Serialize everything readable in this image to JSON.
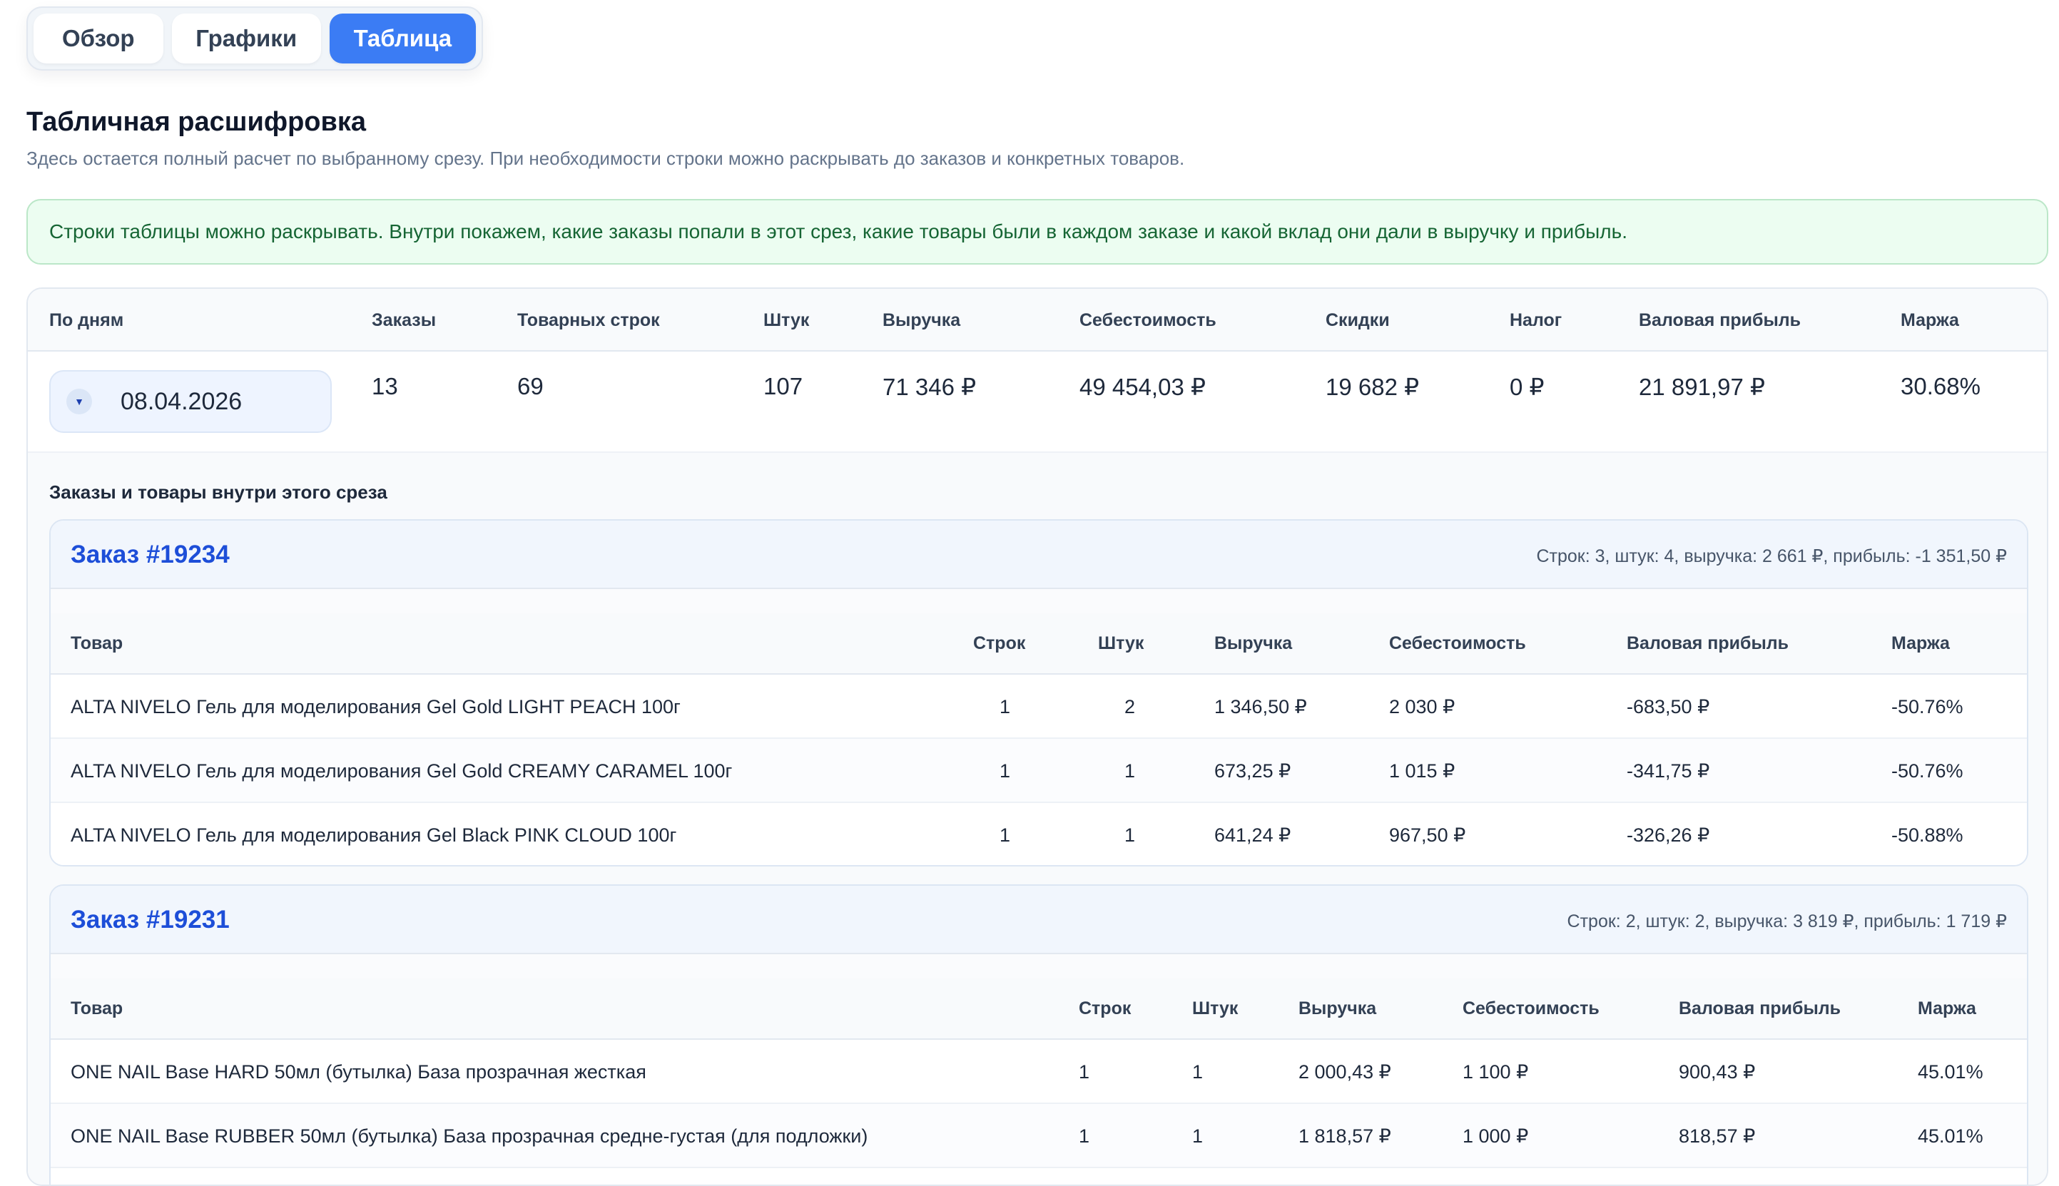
{
  "tabs": [
    {
      "label": "Обзор",
      "active": false
    },
    {
      "label": "Графики",
      "active": false
    },
    {
      "label": "Таблица",
      "active": true
    }
  ],
  "accent_color": "#3b7cf4",
  "section": {
    "title": "Табличная расшифровка",
    "subtitle": "Здесь остается полный расчет по выбранному срезу. При необходимости строки можно раскрывать до заказов и конкретных товаров."
  },
  "notice": "Строки таблицы можно раскрывать. Внутри покажем, какие заказы попали в этот срез, какие товары были в каждом заказе и какой вклад они дали в выручку и прибыль.",
  "table": {
    "headers": [
      "По дням",
      "Заказы",
      "Товарных строк",
      "Штук",
      "Выручка",
      "Себестоимость",
      "Скидки",
      "Налог",
      "Валовая прибыль",
      "Маржа"
    ],
    "row": {
      "expand_icon": "chevron-down-icon",
      "date": "08.04.2026",
      "orders": "13",
      "lines": "69",
      "units": "107",
      "revenue": "71 346 ₽",
      "cost": "49 454,03 ₽",
      "discounts": "19 682 ₽",
      "tax": "0 ₽",
      "gross_profit": "21 891,97 ₽",
      "margin": "30.68%"
    }
  },
  "expansion": {
    "title": "Заказы и товары внутри этого среза",
    "item_headers": [
      "Товар",
      "Строк",
      "Штук",
      "Выручка",
      "Себестоимость",
      "Валовая прибыль",
      "Маржа"
    ],
    "orders": [
      {
        "title": "Заказ #19234",
        "summary": "Строк: 3, штук: 4, выручка: 2 661 ₽, прибыль: -1 351,50 ₽",
        "items": [
          {
            "name": "ALTA NIVELO Гель для моделирования Gel Gold LIGHT PEACH 100г",
            "lines": "1",
            "units": "2",
            "revenue": "1 346,50 ₽",
            "cost": "2 030 ₽",
            "profit": "-683,50 ₽",
            "margin": "-50.76%"
          },
          {
            "name": "ALTA NIVELO Гель для моделирования Gel Gold CREAMY CARAMEL 100г",
            "lines": "1",
            "units": "1",
            "revenue": "673,25 ₽",
            "cost": "1 015 ₽",
            "profit": "-341,75 ₽",
            "margin": "-50.76%"
          },
          {
            "name": "ALTA NIVELO Гель для моделирования Gel Black PINK CLOUD 100г",
            "lines": "1",
            "units": "1",
            "revenue": "641,24 ₽",
            "cost": "967,50 ₽",
            "profit": "-326,26 ₽",
            "margin": "-50.88%"
          }
        ]
      },
      {
        "title": "Заказ #19231",
        "summary": "Строк: 2, штук: 2, выручка: 3 819 ₽, прибыль: 1 719 ₽",
        "items": [
          {
            "name": "ONE NAIL Base HARD 50мл (бутылка) База прозрачная жесткая",
            "lines": "1",
            "units": "1",
            "revenue": "2 000,43 ₽",
            "cost": "1 100 ₽",
            "profit": "900,43 ₽",
            "margin": "45.01%"
          },
          {
            "name": "ONE NAIL Base RUBBER 50мл (бутылка) База прозрачная средне-густая (для подложки)",
            "lines": "1",
            "units": "1",
            "revenue": "1 818,57 ₽",
            "cost": "1 000 ₽",
            "profit": "818,57 ₽",
            "margin": "45.01%"
          }
        ]
      }
    ]
  }
}
